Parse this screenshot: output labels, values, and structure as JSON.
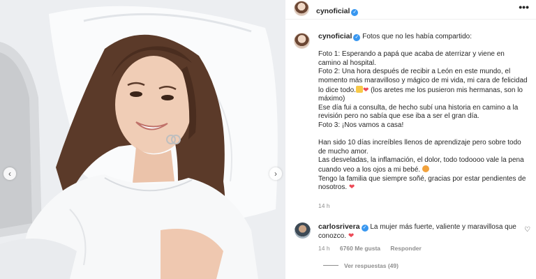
{
  "post": {
    "username": "cynoficial",
    "more_label": "•••",
    "caption": {
      "intro": "Fotos que no les había compartido:",
      "lines_1": [
        "Foto 1: Esperando a papá que acaba de aterrizar y viene en camino al hospital.",
        "Foto 2: Una hora después de recibir a León en este mundo, el momento más maravilloso y mágico de mi vida, mi cara de felicidad lo dice todo."
      ],
      "foto2_tail": "(los aretes me los pusieron mis hermanas, son lo máximo)",
      "lines_2": [
        "Ese día fui a consulta, de hecho subí una historia en camino a la revisión pero no sabía que ese iba a ser el gran día.",
        "Foto 3: ¡Nos vamos a casa!"
      ],
      "para_2": "Han sido 10 días increíbles llenos de aprendizaje pero sobre todo de mucho amor.",
      "para_3": "Las desveladas, la inflamación, el dolor, todo todoooo vale la pena cuando veo a los ojos a mi bebé.",
      "para_4": "Tengo la familia que siempre soñé, gracias por estar pendientes de nosotros."
    },
    "time": "14 h"
  },
  "comment": {
    "username": "carlosrivera",
    "text": "La mujer más fuerte, valiente y maravillosa que conozco.",
    "time": "14 h",
    "likes": "6760 Me gusta",
    "reply_label": "Responder",
    "view_replies": "Ver respuestas (49)"
  },
  "icons": {
    "verified": "verified-badge-icon",
    "heart": "heart-icon",
    "prev": "chevron-left-icon",
    "next": "chevron-right-icon"
  },
  "colors": {
    "verified_blue": "#3897f0",
    "heart_red": "#ed4956",
    "muted": "#8e8e8e"
  }
}
